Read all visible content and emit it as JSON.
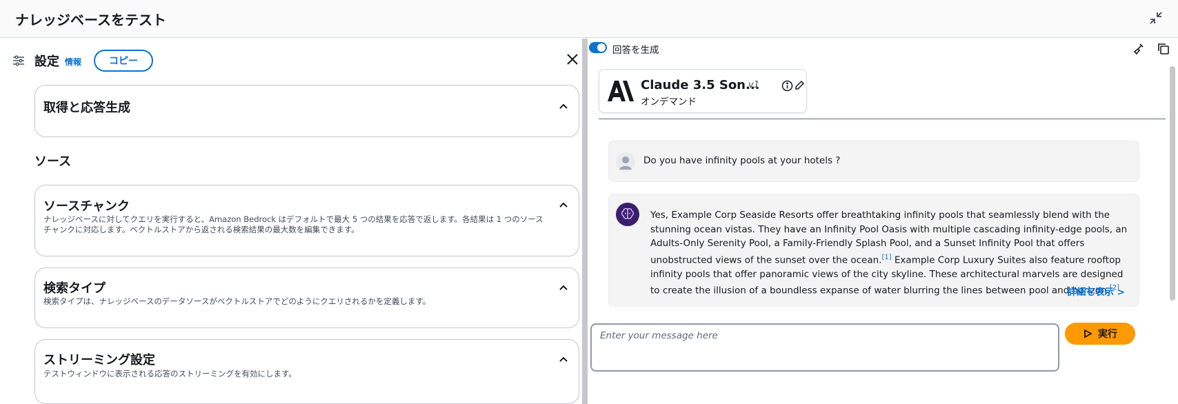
{
  "header": {
    "title": "ナレッジベースをテスト"
  },
  "settings": {
    "title": "設定",
    "info_link": "情報",
    "copy_button": "コピー"
  },
  "sections": {
    "retrieval": {
      "title": "取得と応答生成"
    },
    "source_label": "ソース",
    "source_chunks": {
      "title": "ソースチャンク",
      "description": "ナレッジベースに対してクエリを実行すると、Amazon Bedrock はデフォルトで最大 5 つの結果を応答で返します。各結果は 1 つのソースチャンクに対応します。ベクトルストアから返される検索結果の最大数を編集できます。"
    },
    "search_type": {
      "title": "検索タイプ",
      "description": "検索タイプは、ナレッジベースのデータソースがベクトルストアでどのようにクエリされるかを定義します。"
    },
    "streaming": {
      "title": "ストリーミング設定",
      "description": "テストウィンドウに表示される応答のストリーミングを有効にします。"
    }
  },
  "chat": {
    "generate_toggle_label": "回答を生成",
    "generate_enabled": true,
    "model": {
      "name": "Claude 3.5 Son...",
      "version": "v1",
      "mode": "オンデマンド"
    },
    "user_message": "Do you have infinity pools at your hotels ?",
    "bot_message": {
      "part1": "Yes, Example Corp Seaside Resorts offer breathtaking infinity pools that seamlessly blend with the stunning ocean vistas. They have an Infinity Pool Oasis with multiple cascading infinity-edge pools, an Adults-Only Serenity Pool, a Family-Friendly Splash Pool, and a Sunset Infinity Pool that offers unobstructed views of the sunset over the ocean.",
      "cite1": "[1]",
      "part2": " Example Corp Luxury Suites also feature rooftop infinity pools that offer panoramic views of the city skyline. These architectural marvels are designed to create the illusion of a boundless expanse of water blurring the lines between pool and horizon.",
      "cite2": "[2]",
      "more_link": "詳細を表示 >"
    },
    "input_placeholder": "Enter your message here",
    "run_button": "実行"
  },
  "colors": {
    "accent": "#0972d3",
    "run_button": "#ff9900"
  }
}
